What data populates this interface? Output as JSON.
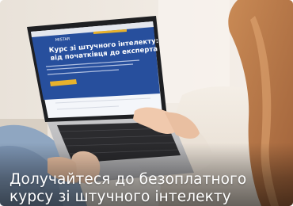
{
  "photo": {
    "screen": {
      "logo": "MISTAR",
      "headline_line1": "Курс зі штучного інтелекту:",
      "headline_line2": "від початківця до експерта"
    }
  },
  "caption": {
    "line1": "Долучайтеся до безоплатного",
    "line2": "курсу зі штучного інтелекту"
  },
  "colors": {
    "screen_blue": "#274f9d",
    "button_yellow": "#e8b22c",
    "caption_text": "#ffffff"
  }
}
